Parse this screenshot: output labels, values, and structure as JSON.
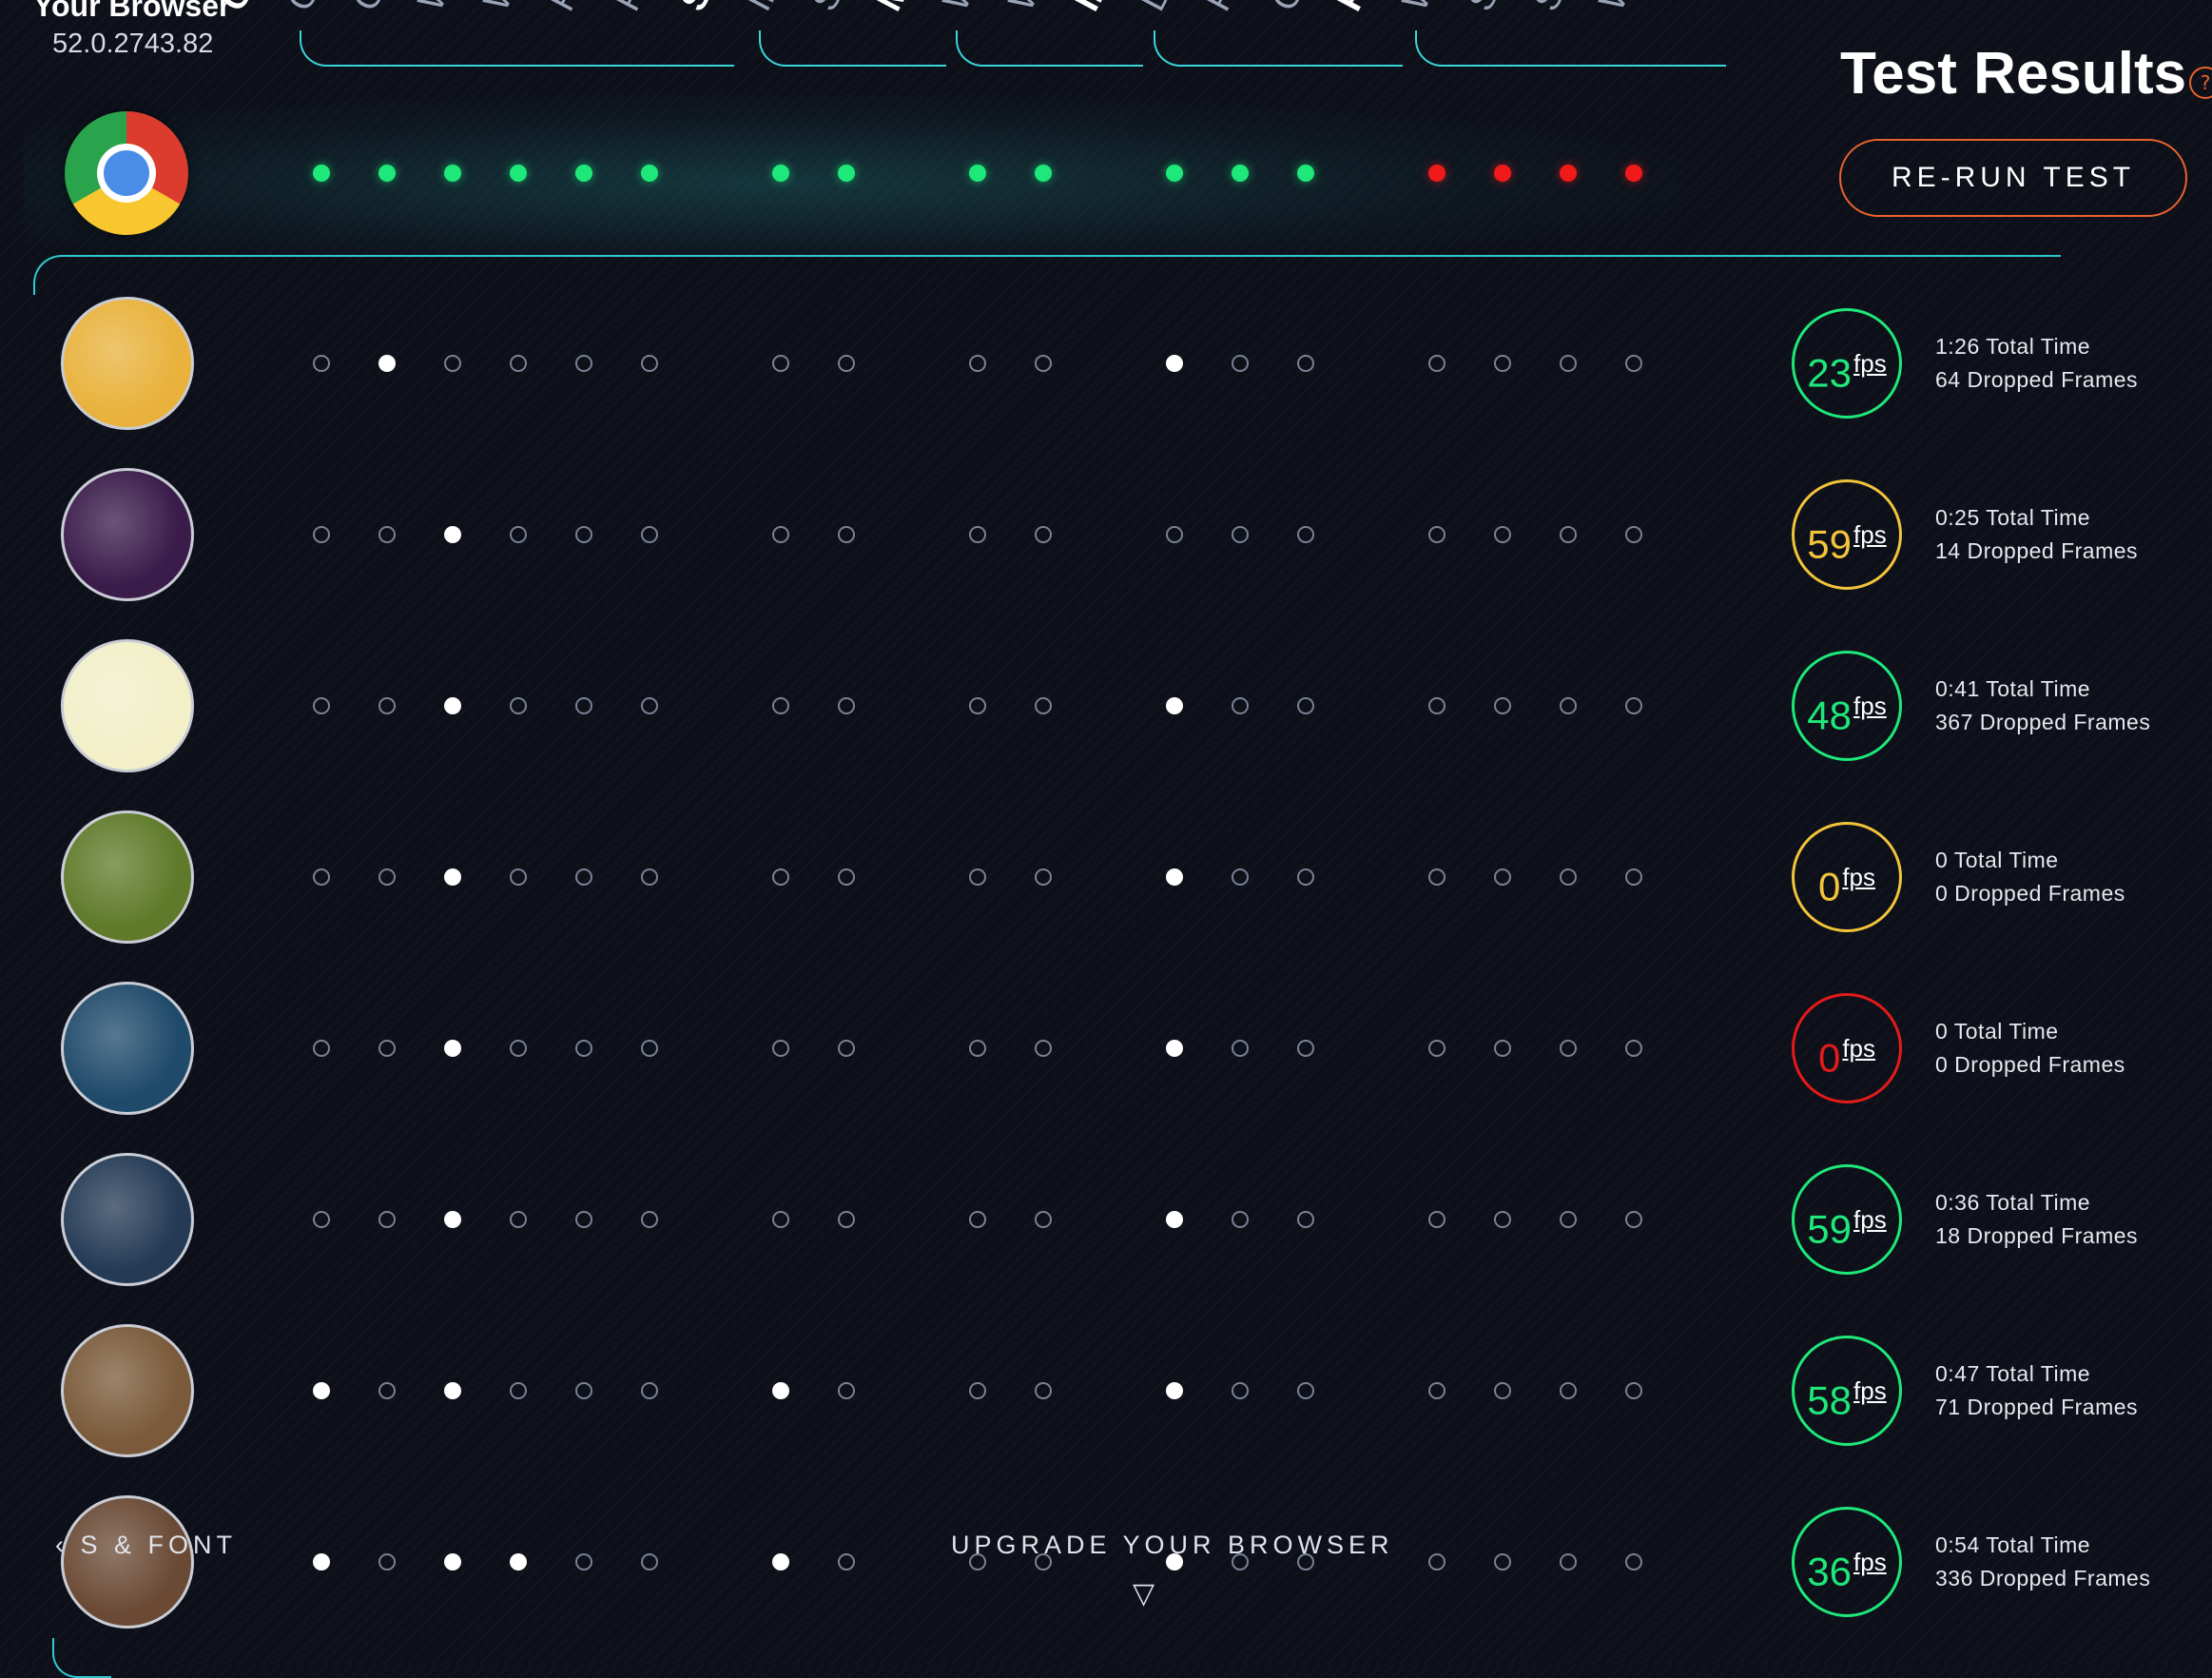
{
  "browser": {
    "label": "Your Browser",
    "version": "52.0.2743.82"
  },
  "columns": [
    {
      "label": "CO",
      "category": true
    },
    {
      "label": "Ot",
      "category": false
    },
    {
      "label": "Co",
      "category": false
    },
    {
      "label": "W",
      "category": false
    },
    {
      "label": "W",
      "category": false
    },
    {
      "label": "Fo",
      "category": false
    },
    {
      "label": "Po",
      "category": false
    },
    {
      "label": "ST",
      "category": true
    },
    {
      "label": "Im",
      "category": false
    },
    {
      "label": "Sc",
      "category": false
    },
    {
      "label": "M",
      "category": true
    },
    {
      "label": "W",
      "category": false
    },
    {
      "label": "W",
      "category": false
    },
    {
      "label": "IN",
      "category": true
    },
    {
      "label": "De",
      "category": false
    },
    {
      "label": "Po",
      "category": false
    },
    {
      "label": "Ga",
      "category": false
    },
    {
      "label": "FO",
      "category": true
    },
    {
      "label": "W",
      "category": false
    },
    {
      "label": "Sr",
      "category": false
    },
    {
      "label": "Sr",
      "category": false
    },
    {
      "label": "W",
      "category": false
    }
  ],
  "support": [
    "pass",
    "pass",
    "pass",
    "pass",
    "pass",
    "pass",
    "pass",
    "pass",
    "pass",
    "pass",
    "pass",
    "pass",
    "pass",
    "fail",
    "fail",
    "fail",
    "fail"
  ],
  "header": {
    "title": "Test Results",
    "help": "?",
    "rerun_label": "RE-RUN TEST"
  },
  "colors": {
    "accent": "#2fc9cf",
    "pass": "#1ee87a",
    "fail": "#f01a1a",
    "button": "#e9622e",
    "fps_green": "#1ee87a",
    "fps_yellow": "#f2c43a",
    "fps_red": "#e41a1a"
  },
  "tests": [
    {
      "thumb": "#e8b23c",
      "dots": [
        0,
        1,
        0,
        0,
        0,
        0,
        0,
        0,
        0,
        0,
        1,
        0,
        0,
        0,
        0,
        0,
        0
      ],
      "fps": "23",
      "fps_color": "fps_green",
      "total_time": "1:26 Total Time",
      "dropped": "64 Dropped Frames"
    },
    {
      "thumb": "#3a1b4a",
      "dots": [
        0,
        0,
        1,
        0,
        0,
        0,
        0,
        0,
        0,
        0,
        0,
        0,
        0,
        0,
        0,
        0,
        0
      ],
      "fps": "59",
      "fps_color": "fps_yellow",
      "total_time": "0:25 Total Time",
      "dropped": "14 Dropped Frames"
    },
    {
      "thumb": "#f2efc9",
      "dots": [
        0,
        0,
        1,
        0,
        0,
        0,
        0,
        0,
        0,
        0,
        1,
        0,
        0,
        0,
        0,
        0,
        0
      ],
      "fps": "48",
      "fps_color": "fps_green",
      "total_time": "0:41 Total Time",
      "dropped": "367 Dropped Frames"
    },
    {
      "thumb": "#5f7a2a",
      "dots": [
        0,
        0,
        1,
        0,
        0,
        0,
        0,
        0,
        0,
        0,
        1,
        0,
        0,
        0,
        0,
        0,
        0
      ],
      "fps": "0",
      "fps_color": "fps_yellow",
      "total_time": "0 Total Time",
      "dropped": "0 Dropped Frames"
    },
    {
      "thumb": "#1f4a6a",
      "dots": [
        0,
        0,
        1,
        0,
        0,
        0,
        0,
        0,
        0,
        0,
        1,
        0,
        0,
        0,
        0,
        0,
        0
      ],
      "fps": "0",
      "fps_color": "fps_red",
      "total_time": "0 Total Time",
      "dropped": "0 Dropped Frames"
    },
    {
      "thumb": "#243a55",
      "dots": [
        0,
        0,
        1,
        0,
        0,
        0,
        0,
        0,
        0,
        0,
        1,
        0,
        0,
        0,
        0,
        0,
        0
      ],
      "fps": "59",
      "fps_color": "fps_green",
      "total_time": "0:36 Total Time",
      "dropped": "18 Dropped Frames"
    },
    {
      "thumb": "#7a5a3a",
      "dots": [
        1,
        0,
        1,
        0,
        0,
        0,
        1,
        0,
        0,
        0,
        1,
        0,
        0,
        0,
        0,
        0,
        0
      ],
      "fps": "58",
      "fps_color": "fps_green",
      "total_time": "0:47 Total Time",
      "dropped": "71 Dropped Frames"
    },
    {
      "thumb": "#6a4a35",
      "dots": [
        1,
        0,
        1,
        1,
        0,
        0,
        1,
        0,
        0,
        0,
        1,
        0,
        0,
        0,
        0,
        0,
        0
      ],
      "fps": "36",
      "fps_color": "fps_green",
      "total_time": "0:54 Total Time",
      "dropped": "336 Dropped Frames"
    }
  ],
  "fps_unit": "fps",
  "footer": {
    "left_link": "‹ S & FONT",
    "center_link": "UPGRADE YOUR BROWSER",
    "arrow": "▽"
  }
}
